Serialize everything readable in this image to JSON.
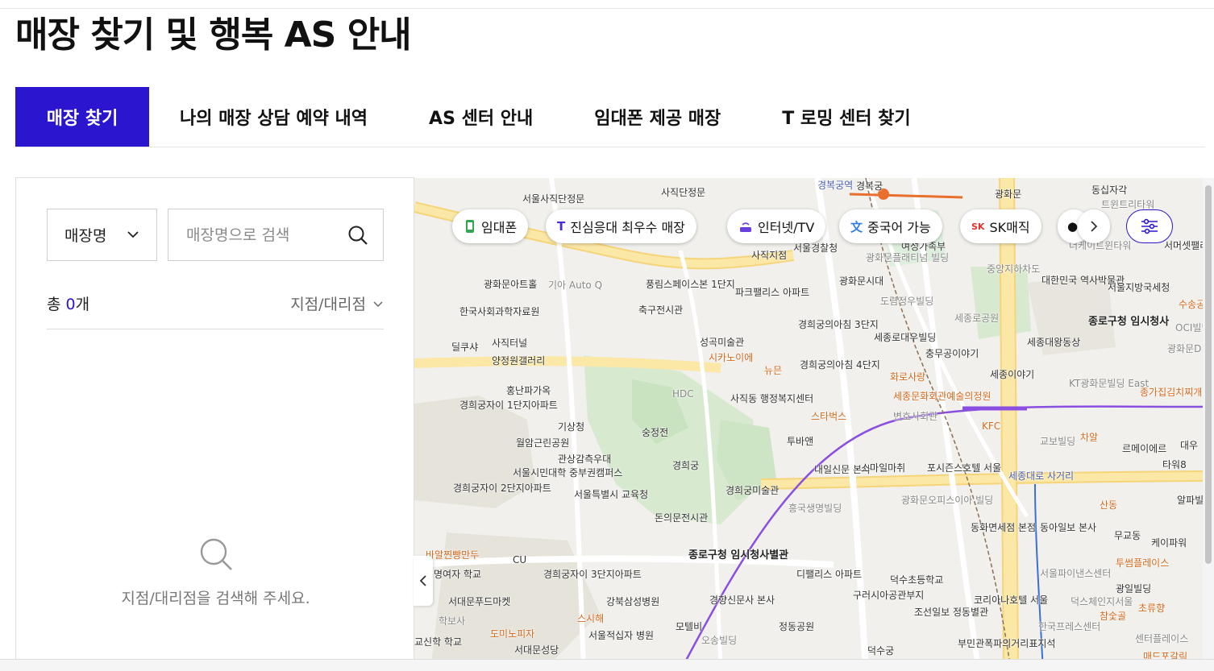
{
  "page": {
    "title": "매장 찾기 및 행복 AS 안내"
  },
  "tabs": [
    {
      "label": "매장 찾기",
      "active": true
    },
    {
      "label": "나의 매장 상담 예약 내역",
      "active": false
    },
    {
      "label": "AS 센터 안내",
      "active": false
    },
    {
      "label": "임대폰 제공 매장",
      "active": false
    },
    {
      "label": "T 로밍 센터 찾기",
      "active": false
    }
  ],
  "search": {
    "type_selected": "매장명",
    "placeholder": "매장명으로 검색",
    "value": ""
  },
  "results": {
    "count_prefix": "총 ",
    "count": "0",
    "count_suffix": "개",
    "filter_label": "지점/대리점"
  },
  "empty_state": {
    "message": "지점/대리점을 검색해 주세요."
  },
  "map": {
    "chips": [
      {
        "label": "임대폰",
        "icon": "phone-icon"
      },
      {
        "label": "진심응대 최우수 매장",
        "icon": "t-logo-icon"
      },
      {
        "label": "인터넷/TV",
        "icon": "router-icon"
      },
      {
        "label": "중국어 가능",
        "icon": "chinese-char-icon"
      },
      {
        "label": "SK매직",
        "icon": "sk-logo-icon"
      }
    ],
    "labels": [
      "서울사직단정문",
      "사직단정문",
      "경복궁역",
      "경복궁",
      "광화문",
      "동십자각",
      "트윈트리타워",
      "광화문아트홀",
      "기아 Auto Q",
      "풍림스페이스본 1단지",
      "파크팰리스 아파트",
      "사직지점",
      "서울경찰청",
      "광화문시대",
      "대한민국 역사박물관",
      "서울지방국세청",
      "종로구청 임시청사",
      "세종로공원",
      "세종대왕동상",
      "한국사회과학자료원",
      "축구전시관",
      "딜쿠샤",
      "사직터널",
      "양정원갤러리",
      "성곡미술관",
      "시카노이에",
      "경희궁의아침 3단지",
      "세종로대우빌딩",
      "충무공이야기",
      "경희궁의아침 4단지",
      "뉴믄",
      "세종이야기",
      "화로사랑",
      "KT광화문빌딩 East",
      "종가집김치찌개",
      "홍난파가옥",
      "HDC",
      "사직동 행정복지센터",
      "세종문화회관예술의정원",
      "경희궁자이 1단지아파트",
      "숭정전",
      "스타벅스",
      "변호사회관",
      "KFC",
      "기상청",
      "월암근린공원",
      "관상감측우대",
      "경희궁",
      "투바앤",
      "교보빌딩",
      "차알",
      "서울시민대학 중부권캠퍼스",
      "서울특별시 교육청",
      "경희궁미술관",
      "내일신문 본사",
      "스마일마취",
      "포시즌스호텔 서울",
      "세종대로 사거리",
      "산동",
      "경희궁자이 2단지아파트",
      "돈의문전시관",
      "흥국생명빌딩",
      "광화문오피스이아 빌딩",
      "동화면세점 본점",
      "동아일보 본사",
      "무교동",
      "케이파워",
      "명여자 학교",
      "서대문푸드마켓",
      "경희궁자이 3단지아파트",
      "강북삼성병원",
      "종로구청 임시청사별관",
      "디팰리스 아파트",
      "덕수초등학교",
      "구러시아공관부지",
      "코리아나호텔 서울",
      "조선일보 정동별관",
      "투썸플레이스",
      "서울파이낸스센터",
      "덕스체인지서울",
      "초류향",
      "참숯골",
      "경향신문사 본사",
      "모텔비",
      "오송빌딩",
      "스시해",
      "도미노피자",
      "서울적십자 병원",
      "서대문성당",
      "정동공원",
      "한국프레스센터",
      "센터플레이스",
      "부민관폭파의거리표지석",
      "덕수궁",
      "매드포갈릭",
      "광일빌딩",
      "알파빌딩",
      "타워8",
      "르메이에르",
      "대우",
      "광화문D",
      "OCI빌딩",
      "수송공원",
      "서머셋팰리스 서울",
      "중앙지하차도",
      "도렴정우빌딩",
      "더케이트윈타워",
      "여성가족부",
      "광화문플래티넘 빌딩",
      "바알찐빵만두",
      "CU",
      "학보사",
      "교신학 학교"
    ]
  }
}
